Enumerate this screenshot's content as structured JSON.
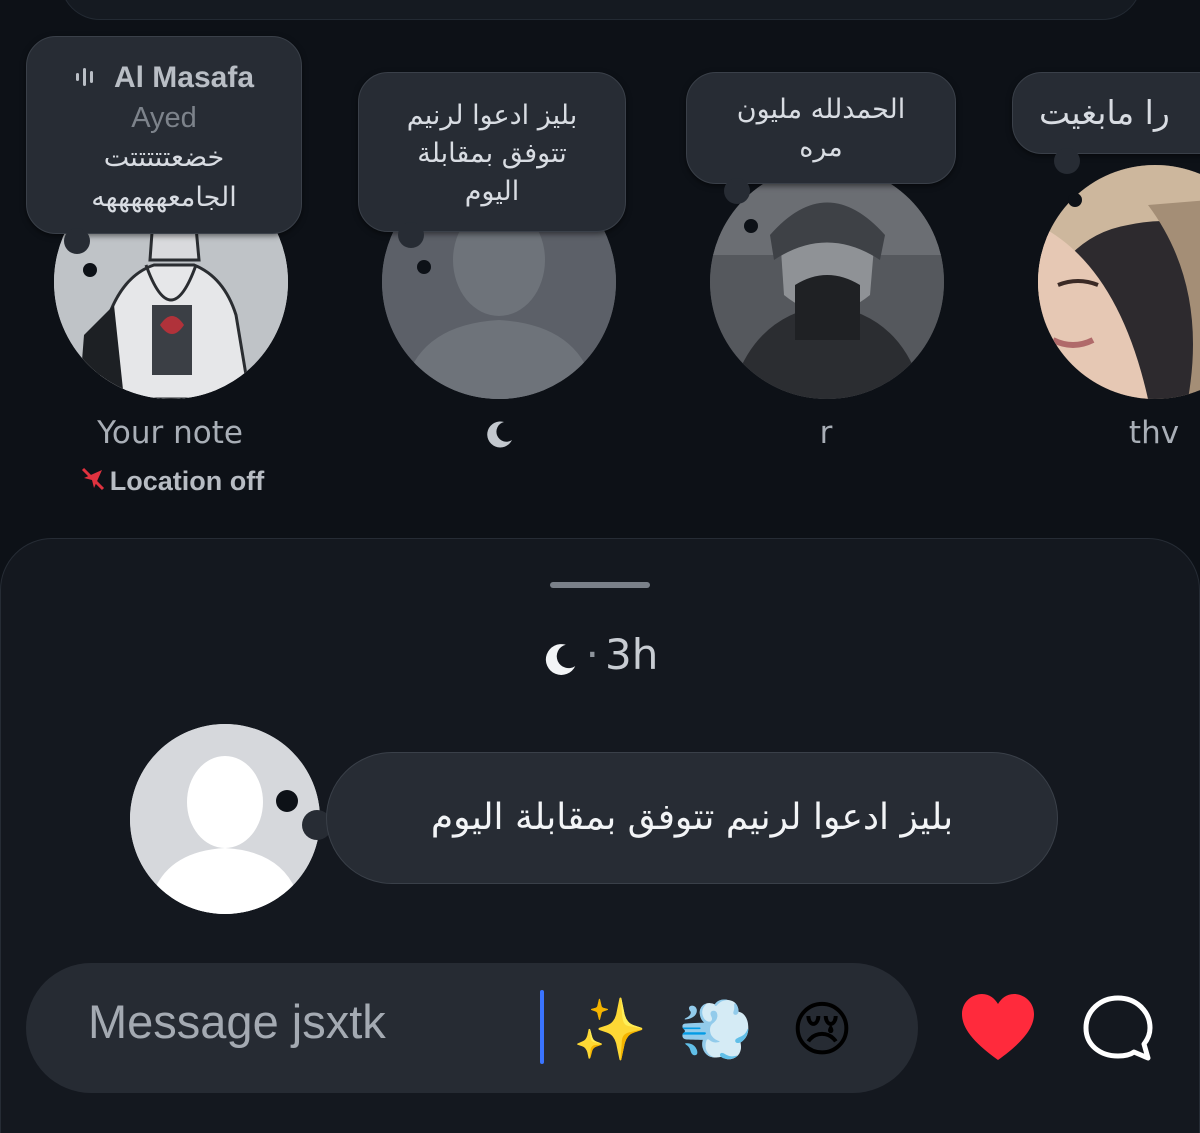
{
  "notes_row": [
    {
      "music": {
        "artist": "Al Masafa",
        "track": "Ayed"
      },
      "note_text_lines": [
        "خضعتتتتتت",
        "الجامعهههههه"
      ],
      "label": "Your note",
      "location": "Location off"
    },
    {
      "note_text_lines": [
        "بليز ادعوا لرنيم",
        "تتوفق بمقابلة",
        "اليوم"
      ],
      "label_icon": "crescent-moon-icon"
    },
    {
      "note_text_lines": [
        "الحمدلله مليون",
        "مره"
      ],
      "label": "r"
    },
    {
      "note_text_lines": [
        "را مابغيت"
      ],
      "label": "thv"
    }
  ],
  "sheet": {
    "author_icon": "crescent-moon-icon",
    "separator": "·",
    "time": "3h",
    "note_text": "بليز ادعوا لرنيم تتوفق بمقابلة اليوم"
  },
  "composer": {
    "placeholder": "Message jsxtk",
    "quick_reactions": [
      "✨",
      "💨",
      "😢"
    ],
    "like_icon": "heart-icon",
    "reply_icon": "chat-bubble-icon"
  },
  "colors": {
    "background": "#0d1117",
    "bubble": "#272c34",
    "accent_caret": "#3a74ff",
    "heart": "#ff2a3c",
    "location_off": "#e0323f"
  }
}
